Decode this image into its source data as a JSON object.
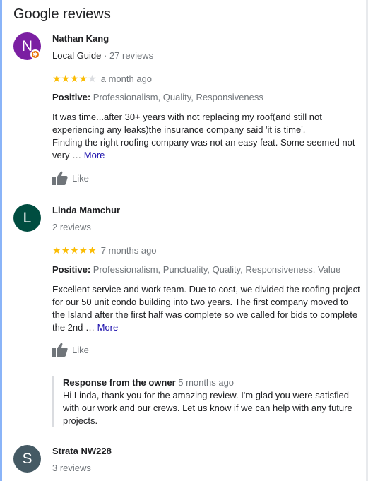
{
  "header": {
    "title": "Google reviews"
  },
  "reviews": [
    {
      "avatar_letter": "N",
      "avatar_color": "#7b1fa2",
      "name": "Nathan Kang",
      "guide_label": "Local Guide",
      "count_label": " · 27 reviews",
      "rating": 4,
      "stars_full": "★★★★",
      "stars_empty": "★",
      "when": "a month ago",
      "attrs_label": "Positive:",
      "attrs_values": " Professionalism, Quality, Responsiveness",
      "text": "It was time...after 30+ years with not replacing my roof(and still not experiencing any leaks)the insurance company said 'it is time'.\nFinding the right roofing company was not an easy feat. Some seemed not very …",
      "more_label": "More",
      "like_label": "Like"
    },
    {
      "avatar_letter": "L",
      "avatar_color": "#004d40",
      "name": "Linda Mamchur",
      "count_label": "2 reviews",
      "rating": 5,
      "stars_full": "★★★★★",
      "when": "7 months ago",
      "attrs_label": "Positive:",
      "attrs_values": " Professionalism, Punctuality, Quality, Responsiveness, Value",
      "text": "Excellent service and work team. Due to cost, we divided the roofing project for our 50 unit condo building into two years.  The first company moved to the Island after the first half was complete so we called for bids to complete the 2nd …",
      "more_label": "More",
      "like_label": "Like",
      "owner_response": {
        "label": "Response from the owner",
        "when": " 5 months ago",
        "text": "Hi Linda, thank you for the amazing review. I'm glad you were satisfied with our work and our crews. Let us know if we can help with any future projects."
      }
    },
    {
      "avatar_letter": "S",
      "avatar_color": "#455a64",
      "name": "Strata NW228",
      "count_label": "3 reviews"
    }
  ]
}
